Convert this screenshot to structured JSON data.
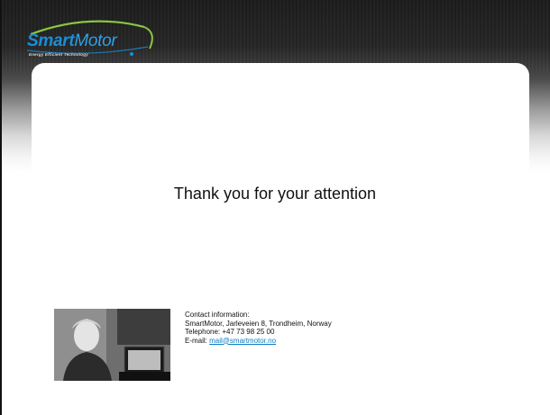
{
  "logo": {
    "brand_part1": "Smart",
    "brand_part2": "Motor",
    "tagline": "Energy Efficient Technology",
    "colors": {
      "blue": "#1a8dd8",
      "green": "#8cc63f"
    }
  },
  "slide": {
    "message": "Thank you for your attention"
  },
  "contact": {
    "heading": "Contact information:",
    "address": "SmartMotor, Jarleveien 8, Trondheim, Norway",
    "telephone": "Telephone: +47 73 98 25 00",
    "email_label": "E-mail: ",
    "email": "mail@smartmotor.no"
  },
  "photo": {
    "icon": "person-photo"
  }
}
